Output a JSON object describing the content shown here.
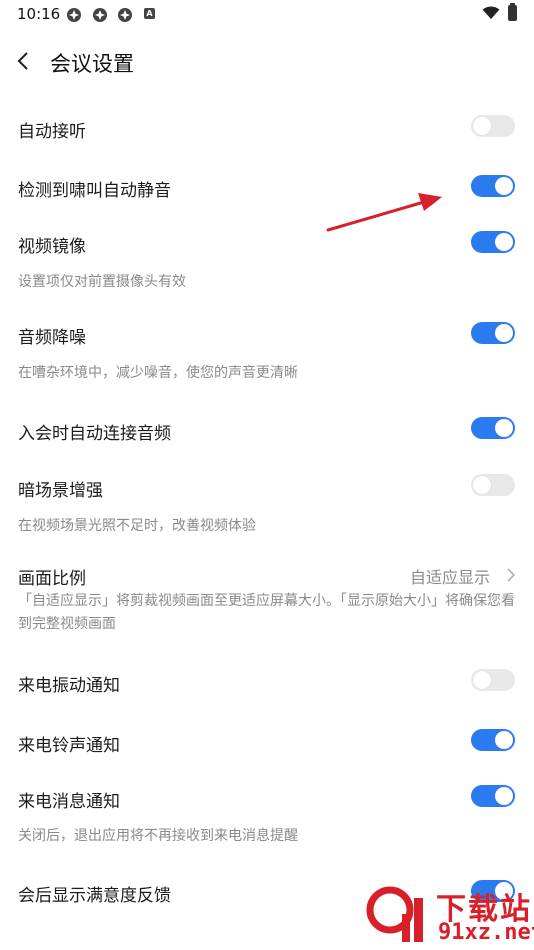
{
  "status_bar": {
    "time": "10:16",
    "badge": "A"
  },
  "header": {
    "title": "会议设置"
  },
  "settings": [
    {
      "label": "自动接听",
      "on": false
    },
    {
      "label": "检测到啸叫自动静音",
      "on": true
    },
    {
      "label": "视频镜像",
      "on": true,
      "desc": "设置项仅对前置摄像头有效"
    },
    {
      "label": "音频降噪",
      "on": true,
      "desc": "在嘈杂环境中，减少噪音，使您的声音更清晰"
    },
    {
      "label": "入会时自动连接音频",
      "on": true
    },
    {
      "label": "暗场景增强",
      "on": false,
      "desc": "在视频场景光照不足时，改善视频体验"
    },
    {
      "label": "来电振动通知",
      "on": false
    },
    {
      "label": "来电铃声通知",
      "on": true
    },
    {
      "label": "来电消息通知",
      "on": true,
      "desc": "关闭后，退出应用将不再接收到来电消息提醒"
    },
    {
      "label": "会后显示满意度反馈",
      "on": true
    }
  ],
  "ratio": {
    "label": "画面比例",
    "value": "自适应显示",
    "desc": "「自适应显示」将剪裁视频画面至更适应屏幕大小。「显示原始大小」将确保您看到完整视频画面"
  },
  "colors": {
    "accent": "#2b7bf0",
    "annotation": "#d8202a"
  },
  "watermark": {
    "line1": "下载站",
    "line2": "91xz.net"
  }
}
